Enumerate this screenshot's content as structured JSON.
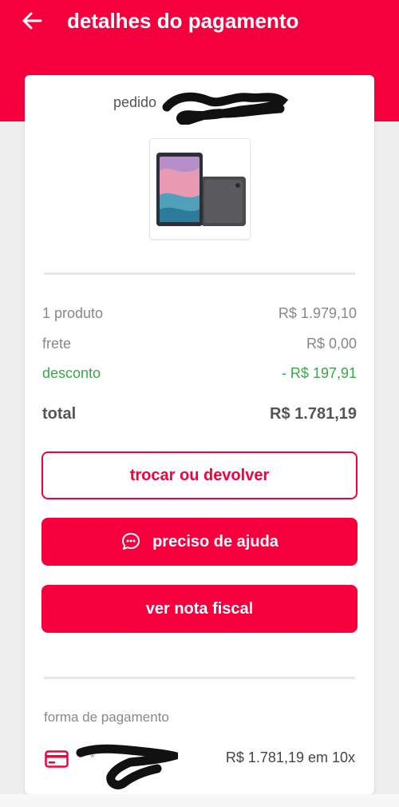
{
  "header": {
    "title": "detalhes do pagamento",
    "back_icon": "arrow-left-icon",
    "color": "#f5003d"
  },
  "order": {
    "label": "pedido"
  },
  "summary": {
    "products_label": "1 produto",
    "products_value": "R$ 1.979,10",
    "shipping_label": "frete",
    "shipping_value": "R$ 0,00",
    "discount_label": "desconto",
    "discount_value": "- R$ 197,91",
    "total_label": "total",
    "total_value": "R$ 1.781,19",
    "discount_color": "#35a84a"
  },
  "actions": {
    "exchange_label": "trocar ou devolver",
    "help_label": "preciso de ajuda",
    "help_icon": "chat-bubble-icon",
    "invoice_label": "ver nota fiscal"
  },
  "payment": {
    "section_label": "forma de pagamento",
    "card_icon": "credit-card-icon",
    "masked_number": "* *",
    "amount": "R$ 1.781,19 em 10x"
  }
}
